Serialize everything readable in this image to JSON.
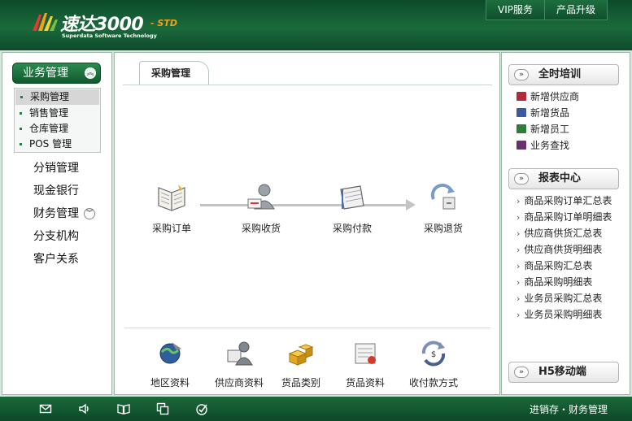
{
  "header": {
    "brand": "速达3000",
    "edition": "- STD",
    "subtitle": "Superdata Software Technology",
    "nav": [
      "VIP服务",
      "产品升级"
    ]
  },
  "sidebar": {
    "active_group": "业务管理",
    "submenu": [
      "采购管理",
      "销售管理",
      "仓库管理",
      "POS 管理"
    ],
    "active_sub": "采购管理",
    "items": [
      "分销管理",
      "现金银行",
      "财务管理",
      "分支机构",
      "客户关系"
    ],
    "expand_marker": "»"
  },
  "main": {
    "tab": "采购管理",
    "flow": [
      "采购订单",
      "采购收货",
      "采购付款",
      "采购退货"
    ],
    "bottom": [
      "地区资料",
      "供应商资料",
      "货品类别",
      "货品资料",
      "收付款方式"
    ]
  },
  "right": {
    "training": {
      "title": "全时培训",
      "items": [
        {
          "label": "新增供应商",
          "color": "#b02a3a"
        },
        {
          "label": "新增货品",
          "color": "#3b5aa0"
        },
        {
          "label": "新增员工",
          "color": "#2e7d3a"
        },
        {
          "label": "业务查找",
          "color": "#6a2f6e"
        }
      ]
    },
    "reports": {
      "title": "报表中心",
      "items": [
        "商品采购订单汇总表",
        "商品采购订单明细表",
        "供应商供货汇总表",
        "供应商供货明细表",
        "商品采购汇总表",
        "商品采购明细表",
        "业务员采购汇总表",
        "业务员采购明细表"
      ]
    },
    "mobile": {
      "title": "H5移动端"
    }
  },
  "footer": {
    "text": "进销存・财务管理",
    "icons": [
      "mail-icon",
      "speaker-icon",
      "book-icon",
      "windows-icon",
      "check-icon"
    ]
  },
  "colors": {
    "header_green": "#0c4b2a",
    "accent_orange": "#f2a21a"
  }
}
